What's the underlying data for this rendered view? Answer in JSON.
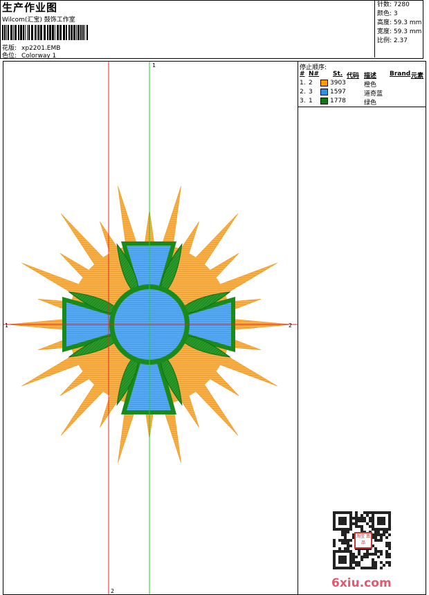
{
  "header": {
    "title": "生产作业图",
    "company": "Wilcom(汇宝) 鼓饰工作室",
    "design_label": "花版:",
    "design_value": "xp2201.EMB",
    "colorway_label": "色位:",
    "colorway_value": "Colorway 1"
  },
  "stats": [
    {
      "label": "针数:",
      "value": "7280"
    },
    {
      "label": "颜色:",
      "value": "3"
    },
    {
      "label": "高度:",
      "value": "59.3 mm"
    },
    {
      "label": "宽度:",
      "value": "59.3 mm"
    },
    {
      "label": "比例:",
      "value": "2.37"
    }
  ],
  "stop_sequence": {
    "title": "停止顺序:",
    "headers": {
      "index": "#",
      "needle": "N#",
      "stitch": "St.",
      "code": "代码",
      "desc": "描述",
      "brand": "Brand",
      "element": "元素"
    },
    "rows": [
      {
        "index": "1.",
        "needle": "2",
        "code": "3903",
        "desc": "橙色",
        "color": "#ff9900"
      },
      {
        "index": "2.",
        "needle": "3",
        "code": "1597",
        "desc": "道奇蓝",
        "color": "#2e8fe8"
      },
      {
        "index": "3.",
        "needle": "1",
        "code": "1778",
        "desc": "绿色",
        "color": "#0f7a14"
      }
    ]
  },
  "guides": {
    "top_marker": "1",
    "bottom_marker": "2",
    "left_marker": "1",
    "right_marker": "2",
    "vertical_green_color": "#22cc33",
    "vertical_red_color": "#ee2222",
    "horizontal_red_color": "#ee2222"
  },
  "design_colors": {
    "orange": "#f5a020",
    "blue": "#3d9cf0",
    "green": "#1a8a1a"
  },
  "watermark": {
    "seal_text": "淘宝 真品",
    "site": "6xiu.com"
  }
}
